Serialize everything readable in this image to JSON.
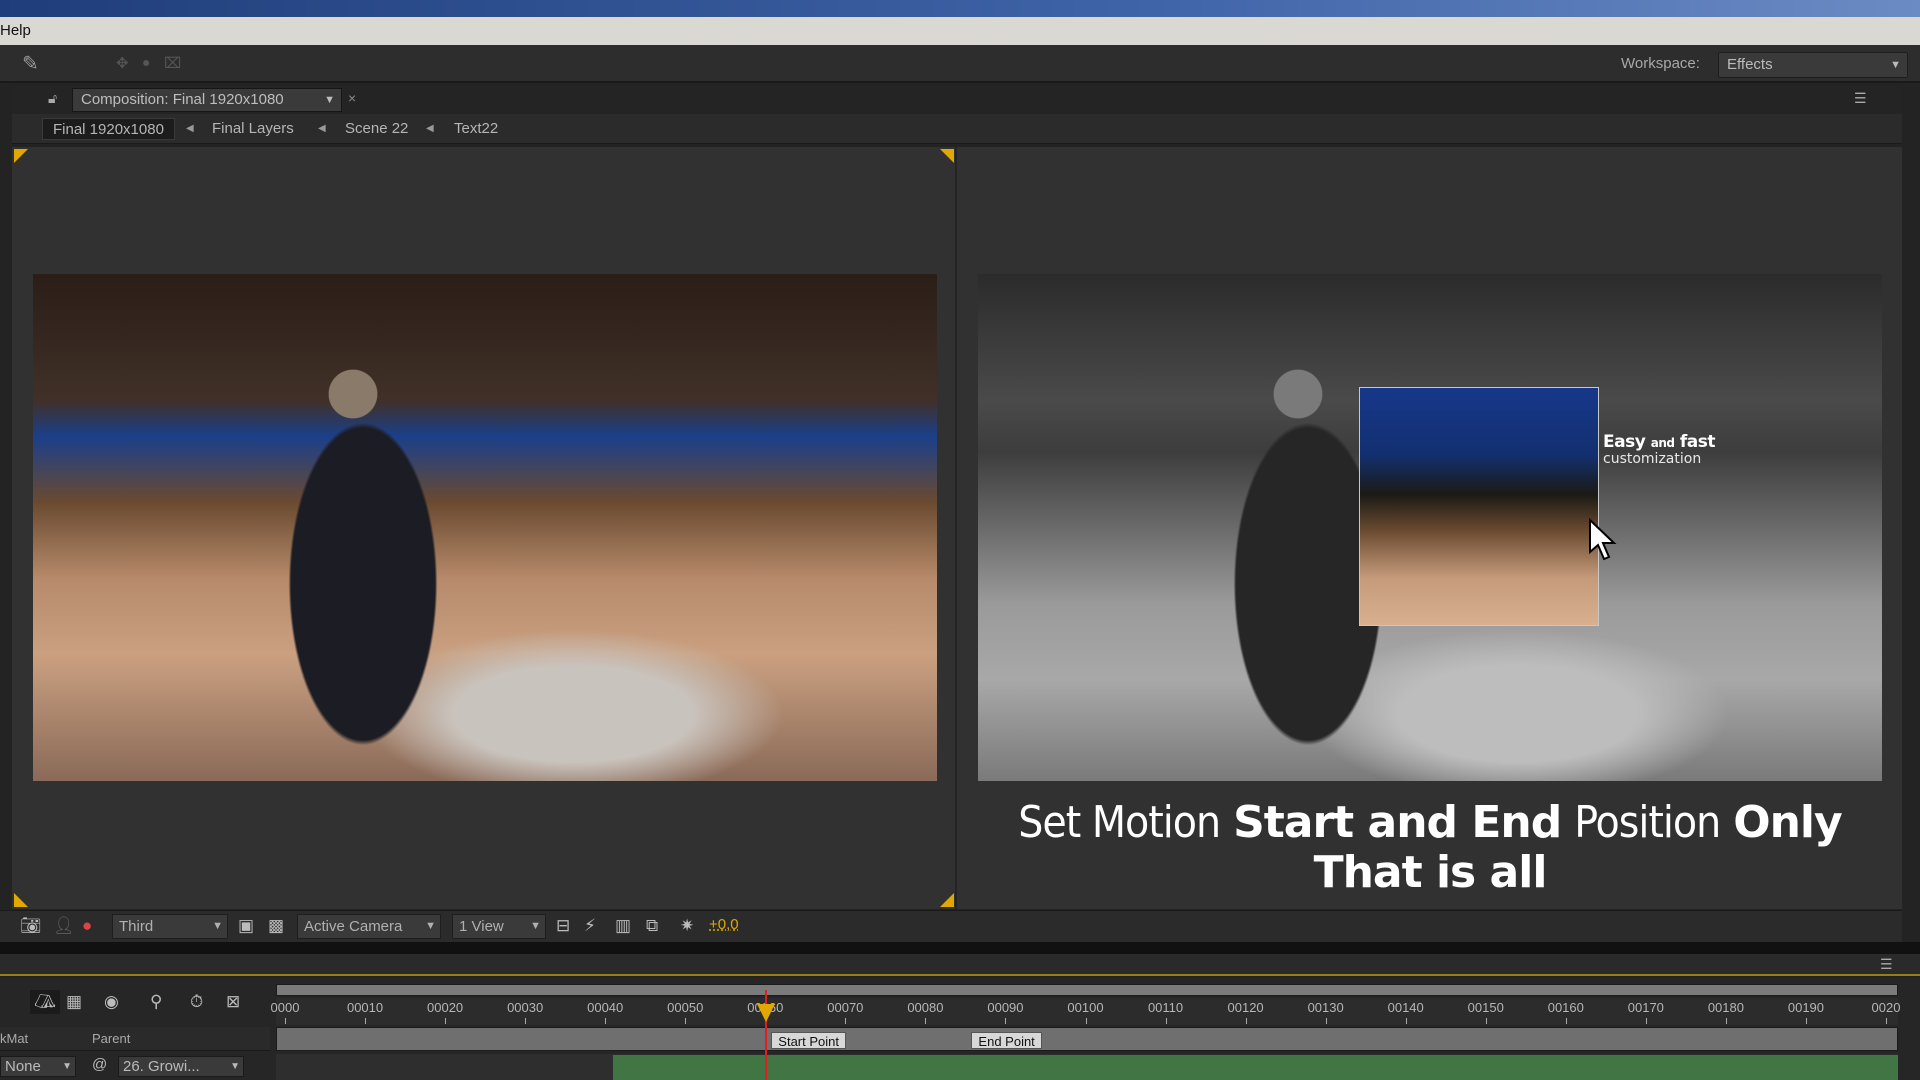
{
  "menu": {
    "items": [
      "Help"
    ]
  },
  "toolbar": {
    "workspace_label": "Workspace:",
    "workspace_value": "Effects"
  },
  "composition": {
    "tab_label": "Composition: Final 1920x1080",
    "breadcrumbs": [
      "Final 1920x1080",
      "Final Layers",
      "Scene 22",
      "Text22"
    ]
  },
  "viewer": {
    "overlay_text_bold": "Easy",
    "overlay_text_small": "and",
    "overlay_text_bold2": "fast",
    "overlay_text_sub": "customization",
    "caption": {
      "line1_a": "Set Motion",
      "line1_b": "Start and End",
      "line1_c": "Position",
      "line1_d": "Only",
      "line2": "That is all"
    },
    "left_image_mode": "color",
    "right_image_mode": "grayscale"
  },
  "viewer_toolbar": {
    "view_layout": "Third",
    "camera": "Active Camera",
    "views": "1 View",
    "exposure": "+0,0",
    "exposure_color": "#e0a800"
  },
  "timeline": {
    "ruler_ticks": [
      "0000",
      "00010",
      "00020",
      "00030",
      "00040",
      "00050",
      "00060",
      "00070",
      "00080",
      "00090",
      "00100",
      "00110",
      "00120",
      "00130",
      "00140",
      "00150",
      "00160",
      "00170",
      "00180",
      "00190",
      "0020"
    ],
    "current_frame": 60,
    "markers": [
      {
        "label": "Start Point",
        "frame": 60
      },
      {
        "label": "End Point",
        "frame": 85
      }
    ],
    "columns": {
      "trkmat": "kMat",
      "parent": "Parent"
    },
    "layer": {
      "trkmat_value": "None",
      "parent_value": "26. Growi..."
    },
    "layer_bar_start_frame": 41,
    "layer_bar_color": "#417544",
    "playhead_color": "#e02020"
  }
}
